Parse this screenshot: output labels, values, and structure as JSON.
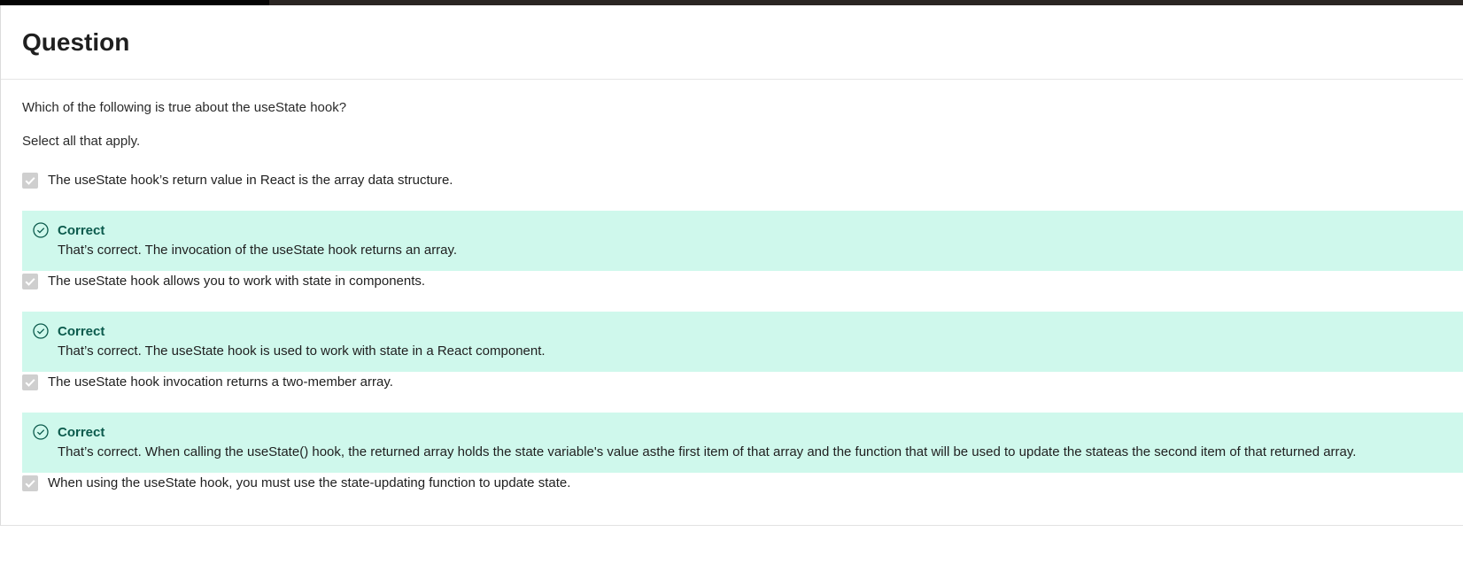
{
  "header": {
    "title": "Question"
  },
  "question": {
    "text": "Which of the following is true about the useState hook?",
    "instruction": "Select all that apply."
  },
  "options": [
    {
      "label": "The useState hook’s return value in React is the array data structure.",
      "checked": true,
      "feedback": {
        "title": "Correct",
        "text": "That’s correct. The invocation of the useState hook returns an array."
      }
    },
    {
      "label": "The useState hook allows you to work with state in components.",
      "checked": true,
      "feedback": {
        "title": "Correct",
        "text": "That’s correct. The useState hook is used to work with state in a React component."
      }
    },
    {
      "label": "The useState hook invocation returns a two-member array.",
      "checked": true,
      "feedback": {
        "title": "Correct",
        "text": "That’s correct. When calling the useState() hook, the returned array holds the state variable's value asthe first item of that array and the function that will be used to update the stateas the second item of that returned array."
      }
    },
    {
      "label": "When using the useState hook, you must use the state-updating function to update state.",
      "checked": true
    }
  ],
  "colors": {
    "feedback_background": "#cff8ec",
    "feedback_title": "#0b5a4c",
    "checkbox": "#cfcfcf"
  },
  "icons": {
    "checkbox": "checkmark-icon",
    "feedback": "check-circle-icon"
  }
}
